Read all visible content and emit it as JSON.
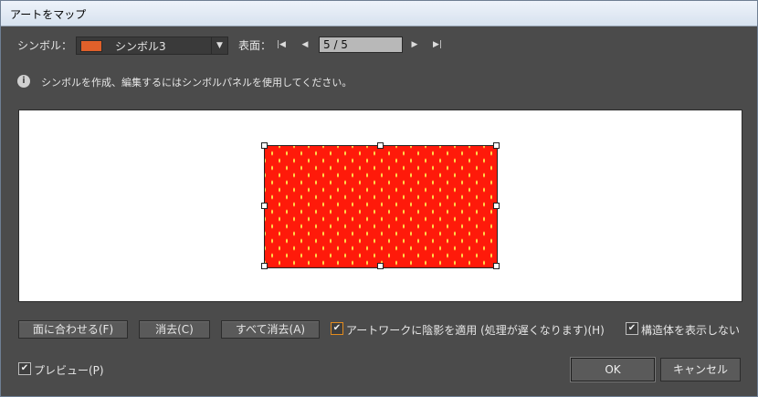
{
  "window": {
    "title": "アートをマップ"
  },
  "symbol": {
    "label": "シンボル：",
    "selected": "シンボル3",
    "swatch_color": "#e0602a"
  },
  "surface": {
    "label": "表面：",
    "value": "5 / 5"
  },
  "info": {
    "text": "シンボルを作成、編集するにはシンボルパネルを使用してください。"
  },
  "preview_art": {
    "fill_color": "#ff1a0a",
    "dot_color": "#ffd94a"
  },
  "buttons": {
    "fit": "面に合わせる(F)",
    "clear": "消去(C)",
    "clear_all": "すべて消去(A)",
    "ok": "OK",
    "cancel": "キャンセル"
  },
  "options": {
    "shade_label": "アートワークに陰影を適用 (処理が遅くなります)(H)",
    "shade_checked": true,
    "hide_geometry_label": "構造体を表示しない",
    "hide_geometry_checked": true,
    "preview_label": "プレビュー(P)",
    "preview_checked": true
  }
}
